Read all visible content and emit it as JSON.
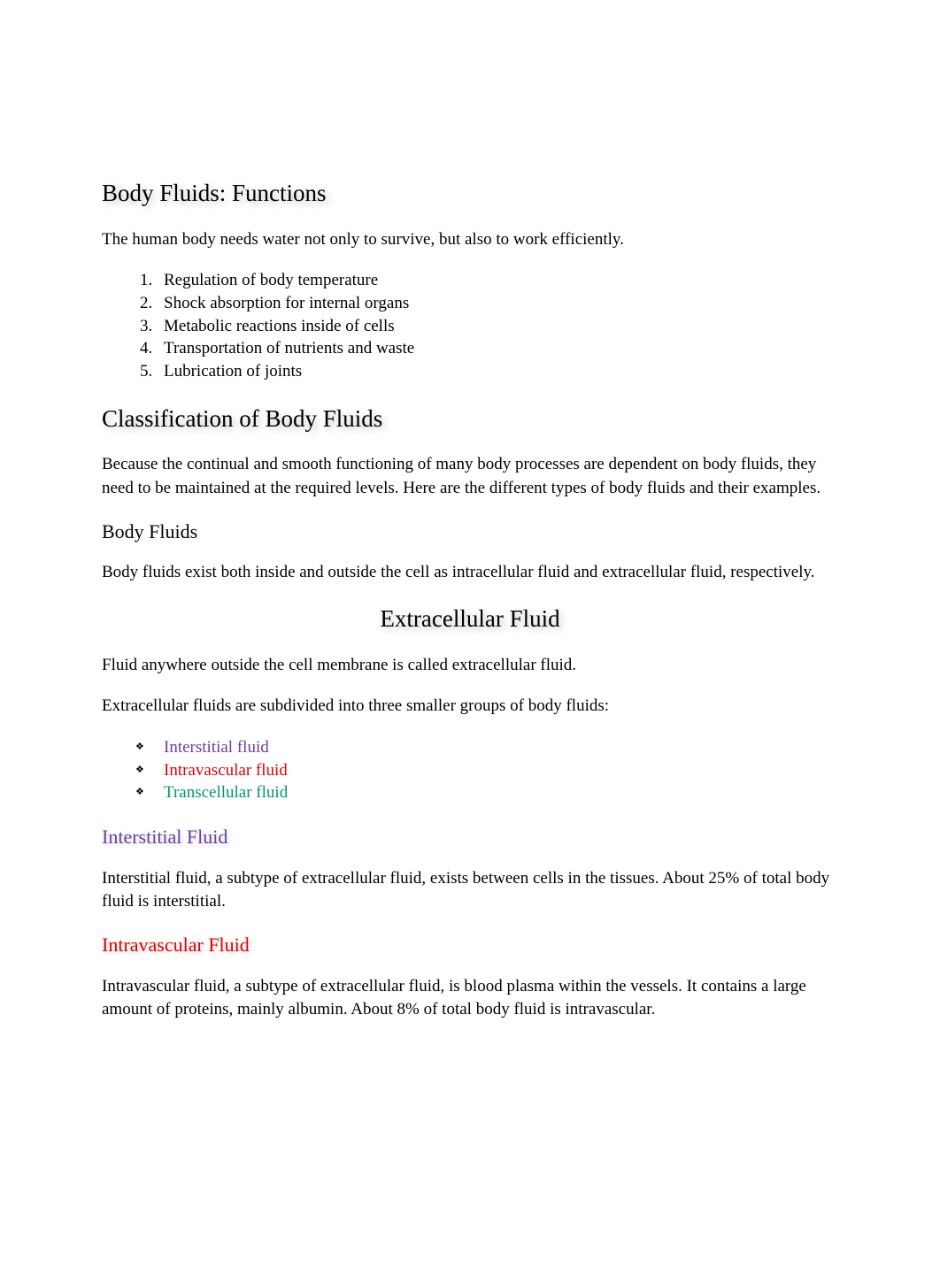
{
  "section_functions": {
    "heading": "Body Fluids: Functions",
    "intro": "The human body needs water not only to survive, but also to work efficiently.",
    "list": [
      "Regulation of body temperature",
      "Shock absorption for internal organs",
      "Metabolic reactions inside of cells",
      "Transportation of nutrients and waste",
      "Lubrication of joints"
    ]
  },
  "section_classification": {
    "heading": "Classification of Body Fluids",
    "intro": "Because the continual and smooth functioning of many body processes are dependent on body fluids, they need to be maintained at the required levels. Here are the different types of body fluids and their examples."
  },
  "body_fluids": {
    "heading": "Body Fluids",
    "text": "Body fluids exist both inside and outside the cell as intracellular fluid and extracellular fluid, respectively."
  },
  "extracellular": {
    "heading": "Extracellular Fluid",
    "p1": "Fluid anywhere outside the cell membrane is called extracellular fluid.",
    "p2": "Extracellular fluids are subdivided into three smaller groups of body fluids:",
    "items": [
      "Interstitial fluid",
      "Intravascular fluid",
      "Transcellular fluid"
    ]
  },
  "interstitial": {
    "heading": "Interstitial Fluid",
    "text": "Interstitial fluid, a subtype of extracellular fluid, exists between cells in the tissues. About 25% of total body fluid is interstitial."
  },
  "intravascular": {
    "heading": "Intravascular Fluid",
    "text": "Intravascular fluid, a subtype of extracellular fluid, is blood plasma within the vessels. It contains a large amount of proteins, mainly albumin. About 8% of total body fluid is intravascular."
  }
}
